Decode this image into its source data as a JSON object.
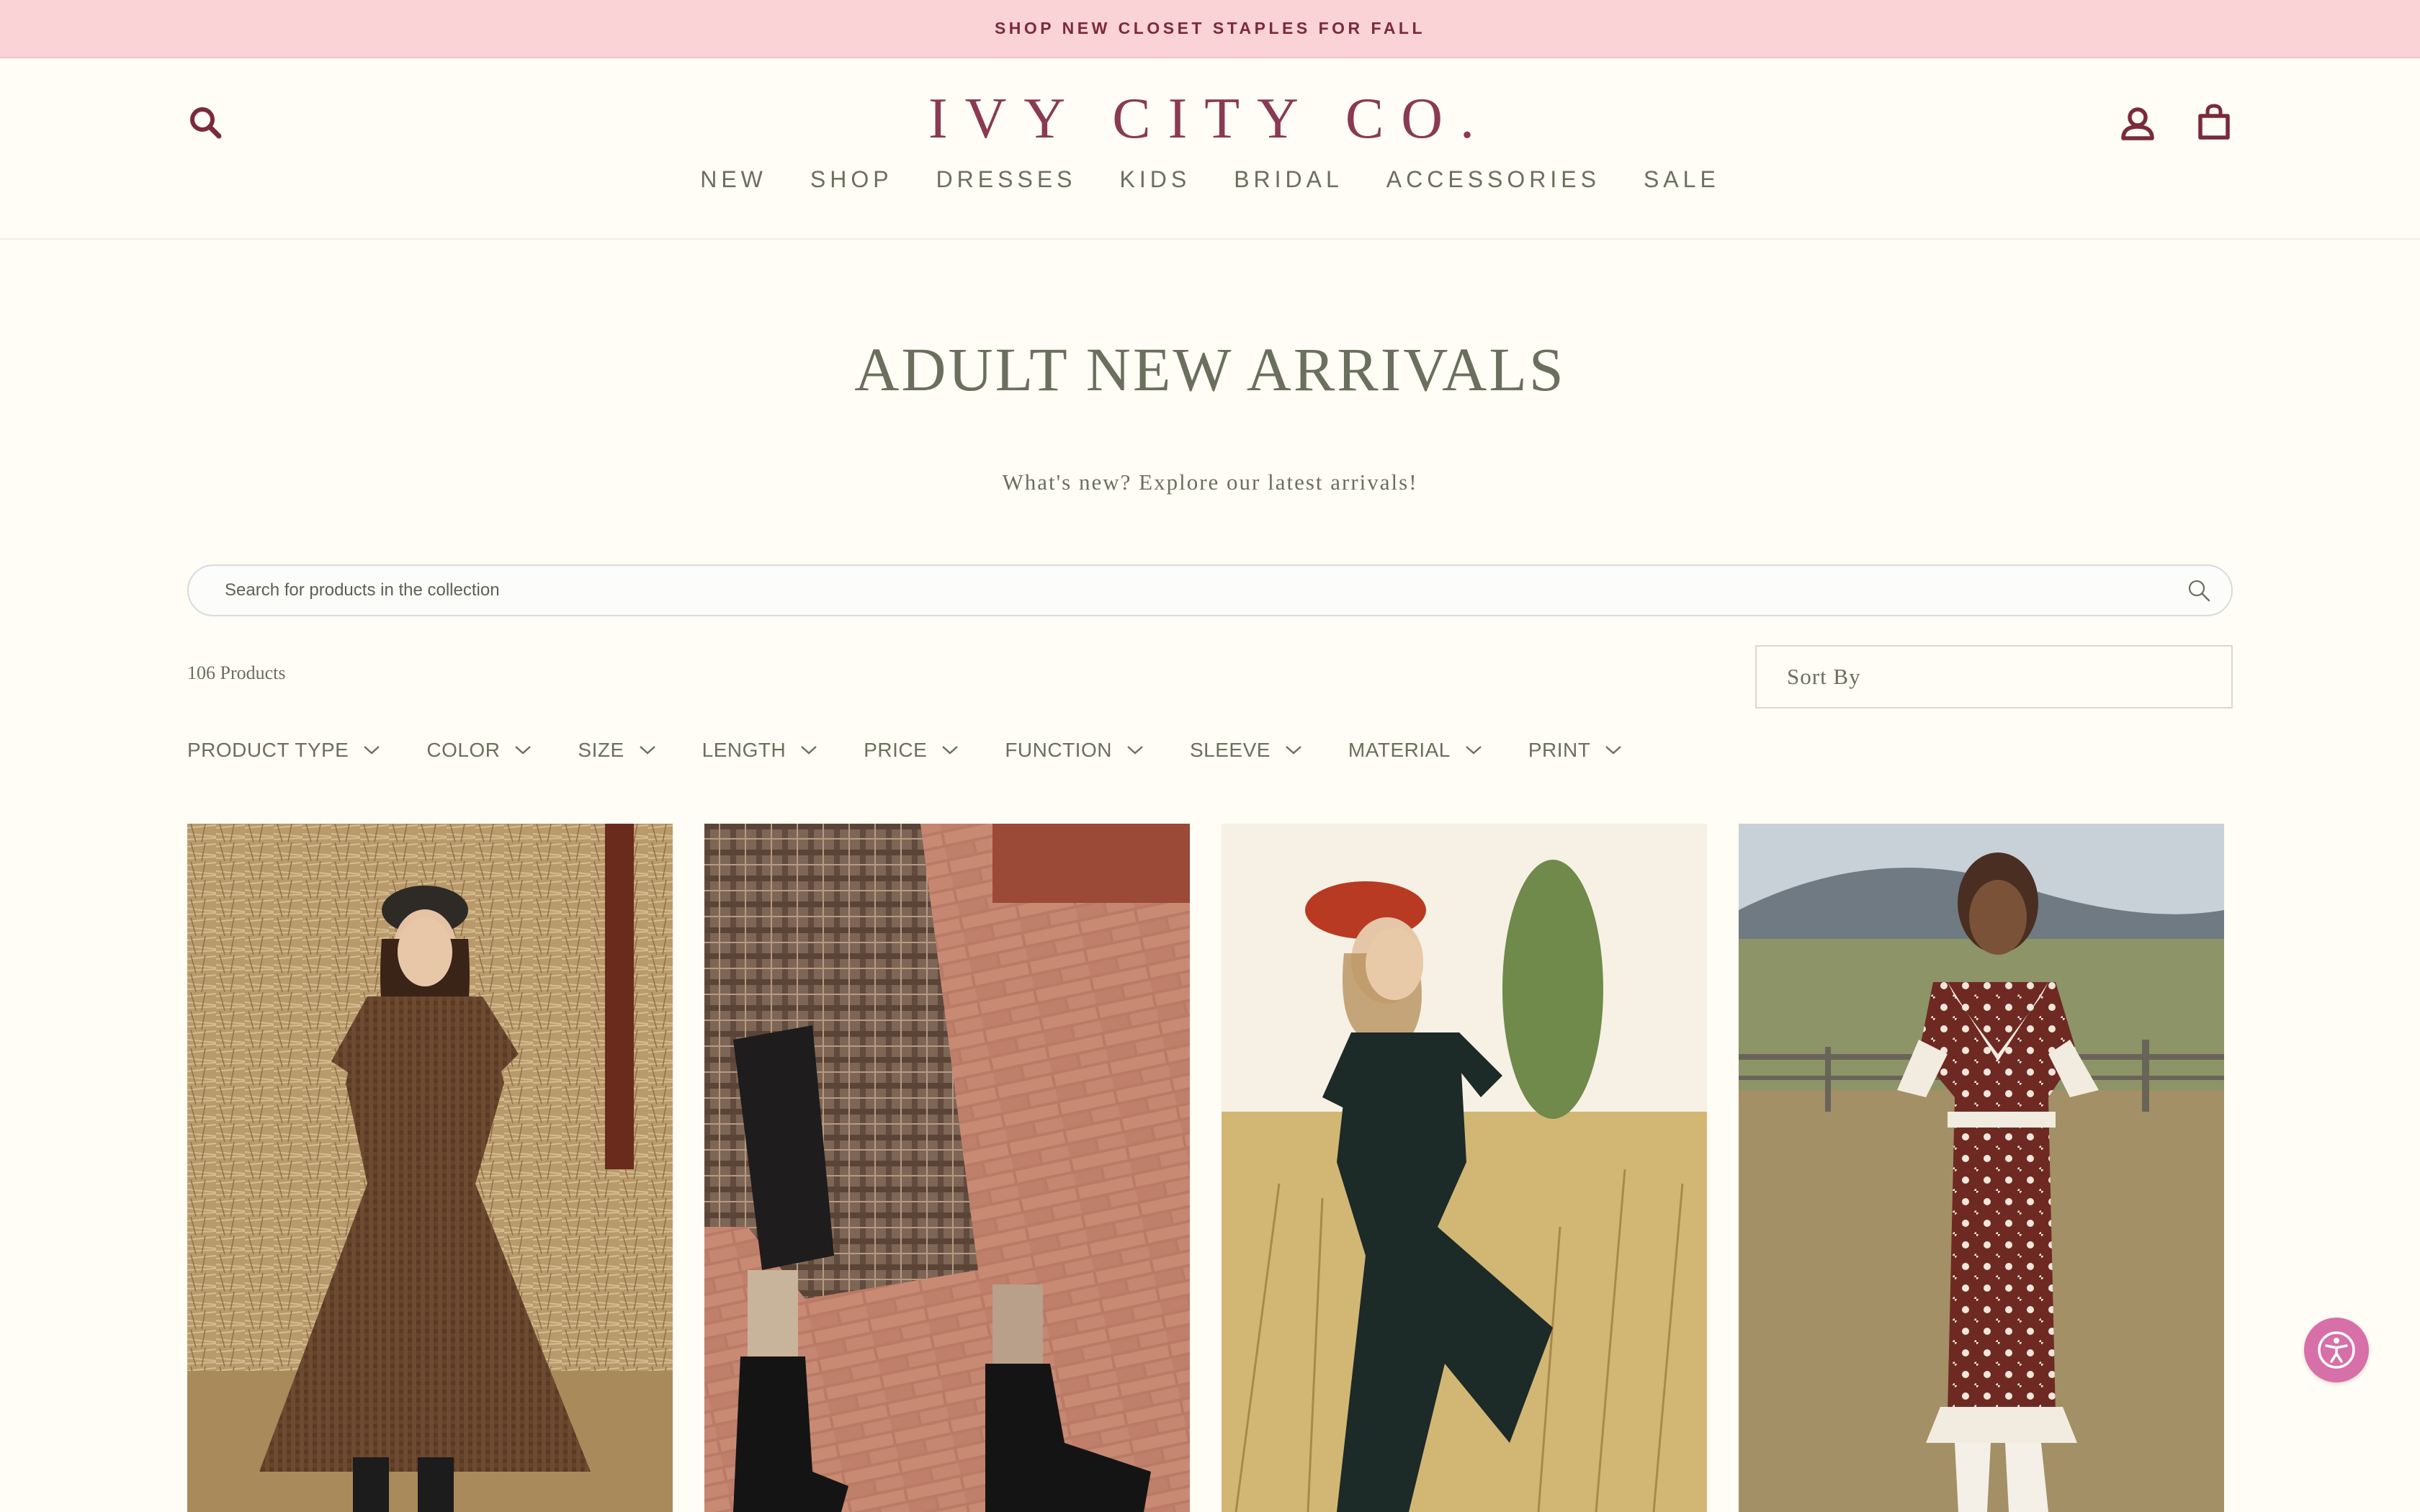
{
  "announcement": {
    "text": "SHOP NEW CLOSET STAPLES FOR FALL"
  },
  "header": {
    "logo": "IVY CITY CO.",
    "nav": [
      "NEW",
      "SHOP",
      "DRESSES",
      "KIDS",
      "BRIDAL",
      "ACCESSORIES",
      "SALE"
    ],
    "icons": [
      "search-icon",
      "account-icon",
      "cart-icon"
    ]
  },
  "collection": {
    "title": "ADULT NEW ARRIVALS",
    "subtitle": "What's new? Explore our latest arrivals!",
    "search_placeholder": "Search for products in the collection",
    "product_count": "106 Products",
    "sort_label": "Sort By",
    "filters": [
      "PRODUCT TYPE",
      "COLOR",
      "SIZE",
      "LENGTH",
      "PRICE",
      "FUNCTION",
      "SLEEVE",
      "MATERIAL",
      "PRINT"
    ]
  },
  "products": [
    {
      "image": "woman-brown-gingham-dress-hay-bales"
    },
    {
      "image": "plaid-coat-black-ankle-boots-brick"
    },
    {
      "image": "woman-dark-green-jumpsuit-red-hat-field"
    },
    {
      "image": "woman-brown-floral-ruffle-dress-field"
    }
  ],
  "colors": {
    "announcement_bg": "#f9d3d6",
    "brand": "#8a3a52",
    "text": "#6b6f5e",
    "page_bg": "#fffdf5",
    "accessibility": "#d76fa8"
  }
}
